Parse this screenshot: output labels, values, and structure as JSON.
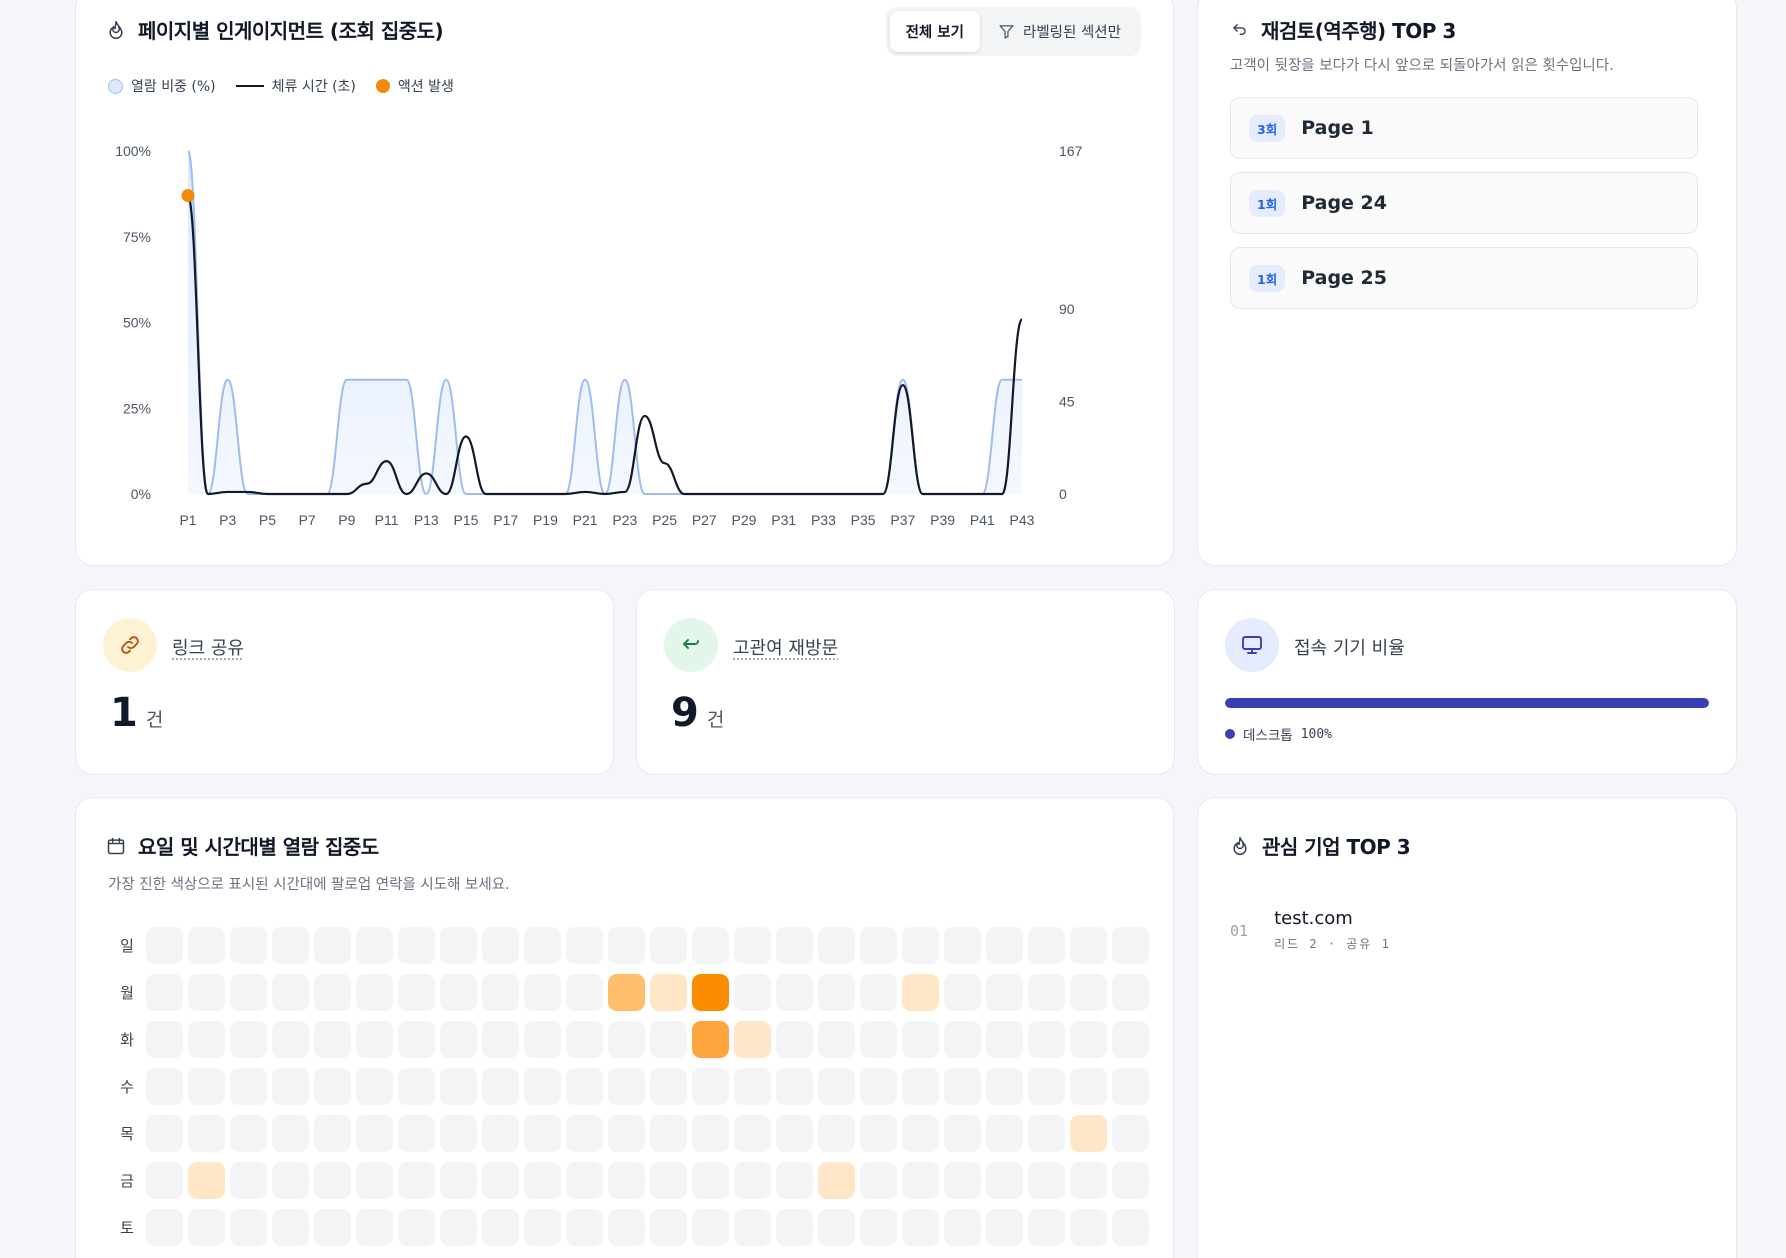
{
  "engagement": {
    "title": "페이지별 인게이지먼트 (조회 집중도)",
    "icon": "flame-icon",
    "toggle": {
      "all_label": "전체 보기",
      "labeled_label": "라벨링된 섹션만"
    },
    "legend": {
      "view_ratio": "열람 비중 (%)",
      "dwell_time": "체류 시간 (초)",
      "action": "액션 발생"
    }
  },
  "chart_data": {
    "type": "area",
    "categories": [
      "P1",
      "P2",
      "P3",
      "P4",
      "P5",
      "P6",
      "P7",
      "P8",
      "P9",
      "P10",
      "P11",
      "P12",
      "P13",
      "P14",
      "P15",
      "P16",
      "P17",
      "P18",
      "P19",
      "P20",
      "P21",
      "P22",
      "P23",
      "P24",
      "P25",
      "P26",
      "P27",
      "P28",
      "P29",
      "P30",
      "P31",
      "P32",
      "P33",
      "P34",
      "P35",
      "P36",
      "P37",
      "P38",
      "P39",
      "P40",
      "P41",
      "P42",
      "P43"
    ],
    "x_tick_labels": [
      "P1",
      "P3",
      "P5",
      "P7",
      "P9",
      "P11",
      "P13",
      "P15",
      "P17",
      "P19",
      "P21",
      "P23",
      "P25",
      "P27",
      "P29",
      "P31",
      "P33",
      "P35",
      "P37",
      "P39",
      "P41",
      "P43"
    ],
    "series": [
      {
        "name": "열람 비중 (%)",
        "axis": "left",
        "values": [
          100,
          0,
          33.3,
          0,
          0,
          0,
          0,
          0,
          33.3,
          33.3,
          33.3,
          33.3,
          0,
          33.3,
          0,
          0,
          0,
          0,
          0,
          0,
          33.3,
          0,
          33.3,
          0,
          0,
          0,
          0,
          0,
          0,
          0,
          0,
          0,
          0,
          0,
          0,
          0,
          33.3,
          0,
          0,
          0,
          0,
          33.3,
          33.3
        ]
      },
      {
        "name": "체류 시간 (초)",
        "axis": "right",
        "values": [
          145,
          0,
          1,
          1,
          0,
          0,
          0,
          0,
          0,
          5,
          16,
          0,
          10,
          0,
          28,
          0,
          0,
          0,
          0,
          0,
          1,
          0,
          1,
          38,
          15,
          0,
          0,
          0,
          0,
          0,
          0,
          0,
          0,
          0,
          0,
          0,
          53,
          0,
          0,
          0,
          0,
          0,
          85
        ]
      },
      {
        "name": "액션 발생",
        "type": "scatter",
        "points": [
          {
            "x": "P1",
            "y": 87
          }
        ]
      }
    ],
    "ylim_left": [
      0,
      100
    ],
    "yticks_left": [
      "0%",
      "25%",
      "50%",
      "75%",
      "100%"
    ],
    "ylim_right": [
      0,
      167
    ],
    "yticks_right": [
      0,
      45,
      90,
      167
    ],
    "grid": false,
    "legend": "top-left"
  },
  "revisit": {
    "title": "재검토(역주행) TOP 3",
    "icon": "return-arrow-icon",
    "subtitle": "고객이 뒷장을 보다가 다시 앞으로 되돌아가서 읽은 횟수입니다.",
    "items": [
      {
        "count": "3회",
        "page": "Page 1"
      },
      {
        "count": "1회",
        "page": "Page 24"
      },
      {
        "count": "1회",
        "page": "Page 25"
      }
    ]
  },
  "share": {
    "label": "링크 공유",
    "value": "1",
    "unit": "건",
    "icon": "link-icon",
    "color": "#fdf3d4"
  },
  "revisitors": {
    "label": "고관여 재방문",
    "value": "9",
    "unit": "건",
    "icon": "return-arrow-icon",
    "color": "#e3f6ea"
  },
  "device": {
    "label": "접속 기기 비율",
    "icon": "monitor-icon",
    "legend_label": "데스크톱",
    "percent": 100,
    "percent_text": "100%",
    "color": "#3b3fb6"
  },
  "heatmap": {
    "title": "요일 및 시간대별 열람 집중도",
    "icon": "calendar-icon",
    "subtitle": "가장 진한 색상으로 표시된 시간대에 팔로업 연락을 시도해 보세요.",
    "days": [
      "일",
      "월",
      "화",
      "수",
      "목",
      "금",
      "토"
    ],
    "hours": 24,
    "colors": [
      "#f3f4f6",
      "#ffe6c6",
      "#ffbe6b",
      "#ffa53d",
      "#fb8c00"
    ],
    "levels": [
      [
        0,
        0,
        0,
        0,
        0,
        0,
        0,
        0,
        0,
        0,
        0,
        0,
        0,
        0,
        0,
        0,
        0,
        0,
        0,
        0,
        0,
        0,
        0,
        0
      ],
      [
        0,
        0,
        0,
        0,
        0,
        0,
        0,
        0,
        0,
        0,
        0,
        2,
        1,
        4,
        0,
        0,
        0,
        0,
        1,
        0,
        0,
        0,
        0,
        0
      ],
      [
        0,
        0,
        0,
        0,
        0,
        0,
        0,
        0,
        0,
        0,
        0,
        0,
        0,
        3,
        1,
        0,
        0,
        0,
        0,
        0,
        0,
        0,
        0,
        0
      ],
      [
        0,
        0,
        0,
        0,
        0,
        0,
        0,
        0,
        0,
        0,
        0,
        0,
        0,
        0,
        0,
        0,
        0,
        0,
        0,
        0,
        0,
        0,
        0,
        0
      ],
      [
        0,
        0,
        0,
        0,
        0,
        0,
        0,
        0,
        0,
        0,
        0,
        0,
        0,
        0,
        0,
        0,
        0,
        0,
        0,
        0,
        0,
        0,
        1,
        0
      ],
      [
        0,
        1,
        0,
        0,
        0,
        0,
        0,
        0,
        0,
        0,
        0,
        0,
        0,
        0,
        0,
        0,
        1,
        0,
        0,
        0,
        0,
        0,
        0,
        0
      ],
      [
        0,
        0,
        0,
        0,
        0,
        0,
        0,
        0,
        0,
        0,
        0,
        0,
        0,
        0,
        0,
        0,
        0,
        0,
        0,
        0,
        0,
        0,
        0,
        0
      ]
    ]
  },
  "companies": {
    "title": "관심 기업 TOP 3",
    "icon": "flame-icon",
    "items": [
      {
        "rank": "01",
        "name": "test.com",
        "meta": "리드 2 · 공유 1"
      }
    ]
  }
}
